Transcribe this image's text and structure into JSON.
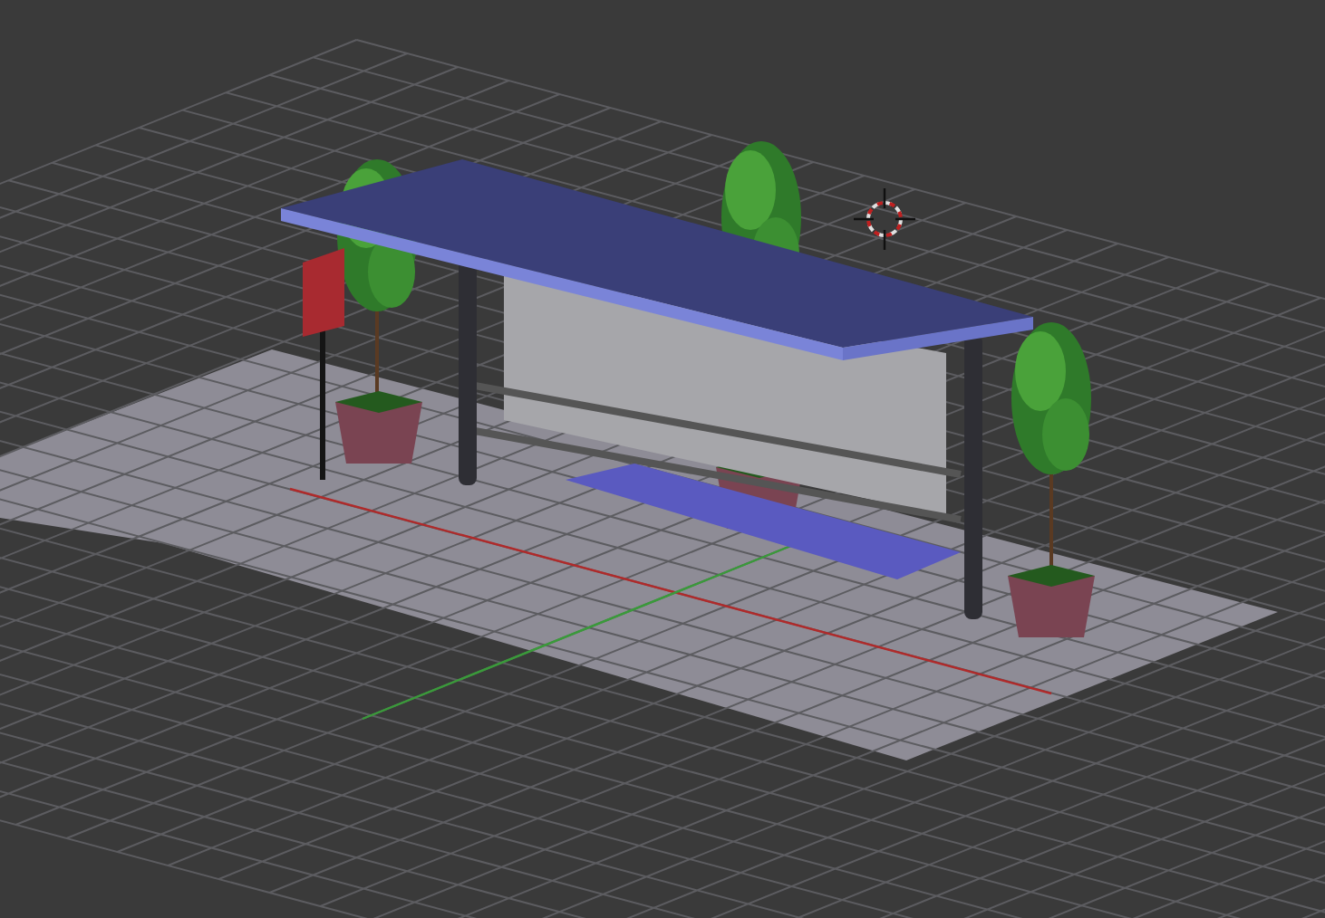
{
  "viewport": {
    "grid_visible": true,
    "axes_visible": true,
    "cursor_visible": true
  }
}
